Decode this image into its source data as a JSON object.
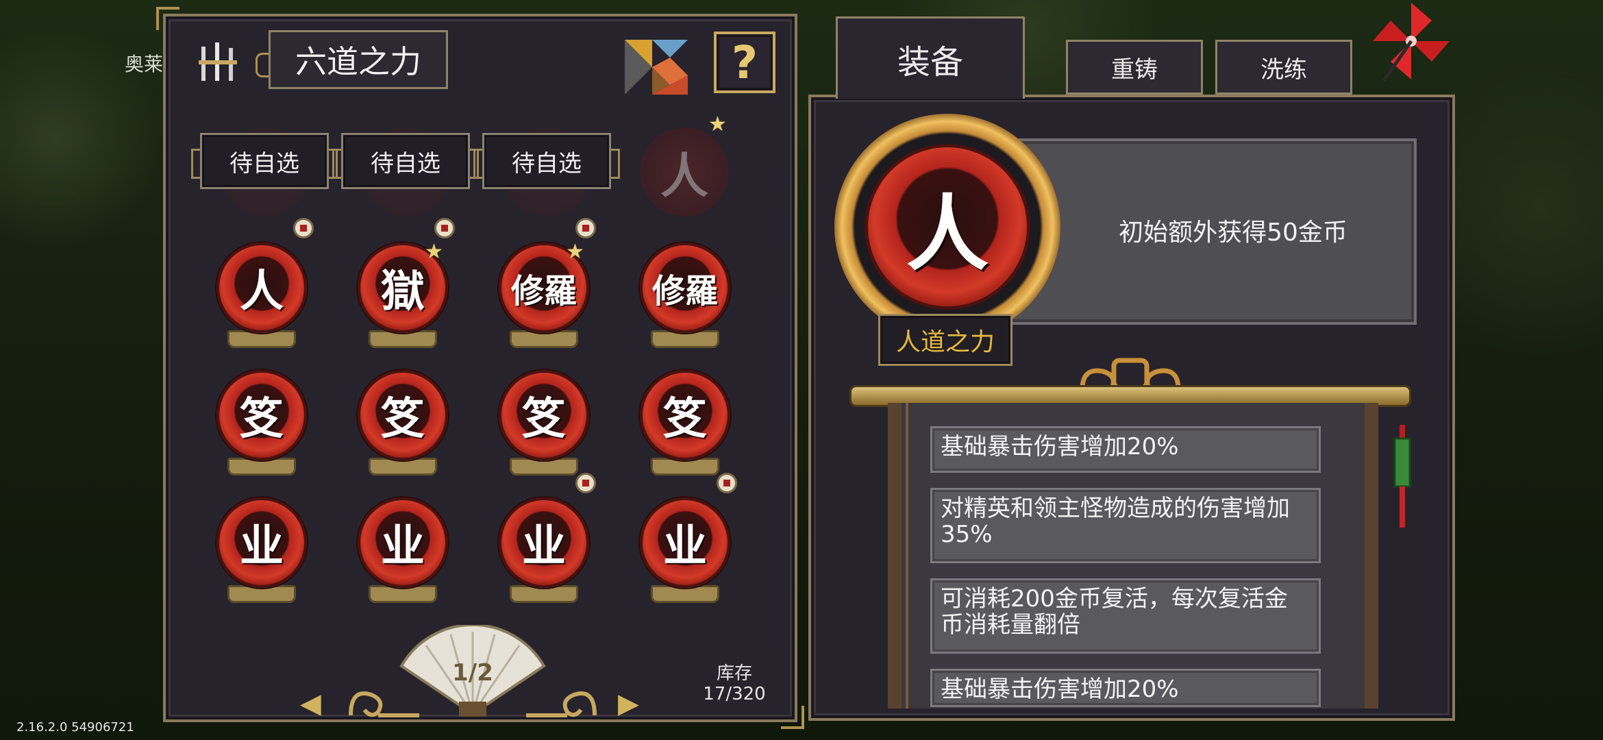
{
  "background": {
    "player_name": "奥莱"
  },
  "version": "2.16.2.0 54906721",
  "left_panel": {
    "title": "六道之力",
    "help_label": "?",
    "pending_slots": [
      "待自选",
      "待自选",
      "待自选"
    ],
    "ghost_slot_char": "人",
    "orbs": [
      {
        "char": "人"
      },
      {
        "char": "獄"
      },
      {
        "char": "修羅"
      },
      {
        "char": "修羅"
      },
      {
        "char": "笅"
      },
      {
        "char": "笅"
      },
      {
        "char": "笅"
      },
      {
        "char": "笅"
      },
      {
        "char": "业"
      },
      {
        "char": "业"
      },
      {
        "char": "业"
      },
      {
        "char": "业"
      }
    ],
    "page": "1/2",
    "stock_label": "库存",
    "stock_value": "17/320"
  },
  "right_panel": {
    "tabs": [
      {
        "label": "装备",
        "active": true
      },
      {
        "label": "重铸",
        "active": false
      },
      {
        "label": "洗练",
        "active": false
      }
    ],
    "selected": {
      "char": "人",
      "name": "人道之力",
      "description": "初始额外获得50金币"
    },
    "attributes": [
      "基础暴击伤害增加20%",
      "对精英和领主怪物造成的伤害增加35%",
      "可消耗200金币复活，每次复活金币消耗量翻倍",
      "基础暴击伤害增加20%"
    ]
  },
  "colors": {
    "panel_bg": "#27232c",
    "accent_gold": "#e6b93c",
    "orb_red": "#d33a28"
  }
}
